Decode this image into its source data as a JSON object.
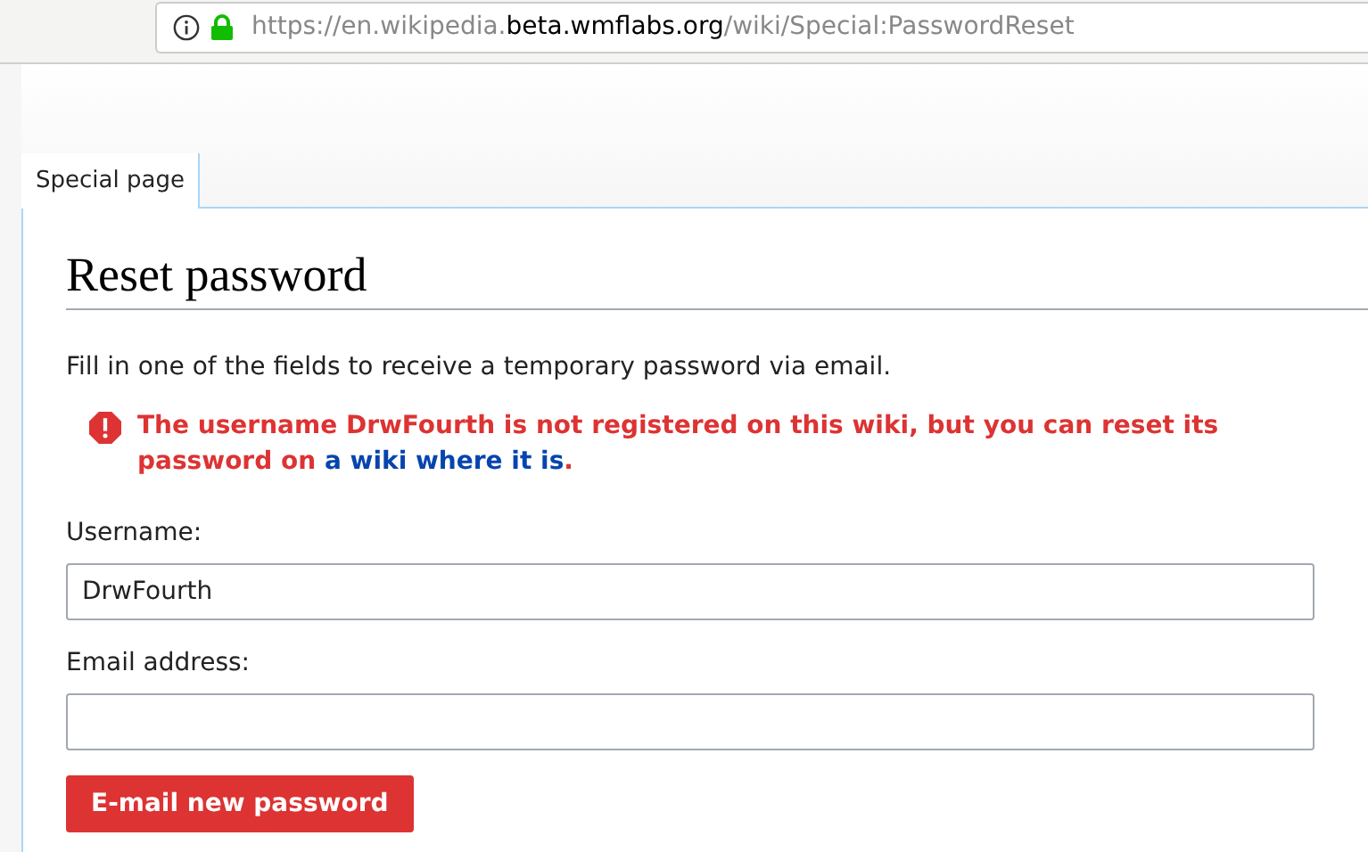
{
  "address_bar": {
    "url_prefix": "https://en.wikipedia.",
    "url_host": "beta.wmflabs.org",
    "url_path": "/wiki/Special:PasswordReset",
    "secure": true
  },
  "tabs": [
    {
      "label": "Special page",
      "selected": true
    }
  ],
  "heading": "Reset password",
  "intro": "Fill in one of the fields to receive a temporary password via email.",
  "error": {
    "before": "The username DrwFourth is not registered on this wiki, but you can reset its password on ",
    "link": "a wiki where it is",
    "after": "."
  },
  "fields": [
    {
      "label": "Username:",
      "value": "DrwFourth"
    },
    {
      "label": "Email address:"
    }
  ],
  "submit_button": "E-mail new password"
}
